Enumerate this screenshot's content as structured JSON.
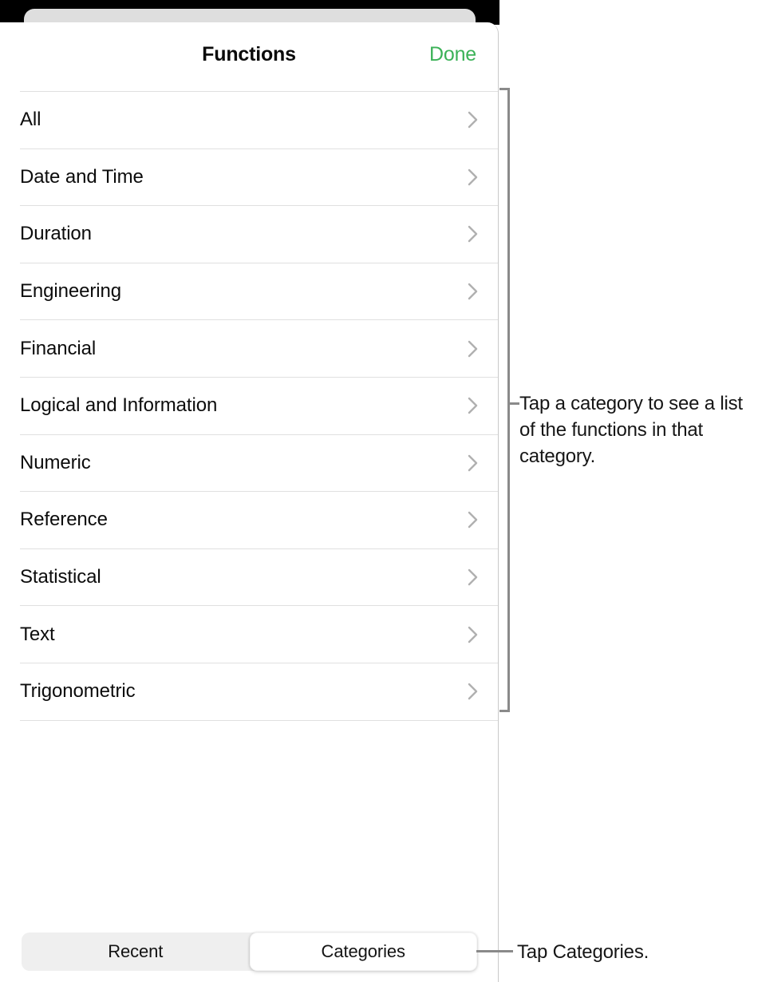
{
  "header": {
    "title": "Functions",
    "done_label": "Done"
  },
  "list": {
    "items": [
      {
        "label": "All",
        "chevron": "chevron-right-icon"
      },
      {
        "label": "Date and Time",
        "chevron": "chevron-right-icon"
      },
      {
        "label": "Duration",
        "chevron": "chevron-right-icon"
      },
      {
        "label": "Engineering",
        "chevron": "chevron-right-icon"
      },
      {
        "label": "Financial",
        "chevron": "chevron-right-icon"
      },
      {
        "label": "Logical and Information",
        "chevron": "chevron-right-icon"
      },
      {
        "label": "Numeric",
        "chevron": "chevron-right-icon"
      },
      {
        "label": "Reference",
        "chevron": "chevron-right-icon"
      },
      {
        "label": "Statistical",
        "chevron": "chevron-right-icon"
      },
      {
        "label": "Text",
        "chevron": "chevron-right-icon"
      },
      {
        "label": "Trigonometric",
        "chevron": "chevron-right-icon"
      }
    ]
  },
  "segmented_control": {
    "options": [
      {
        "label": "Recent",
        "selected": false
      },
      {
        "label": "Categories",
        "selected": true
      }
    ],
    "recent_label": "Recent",
    "categories_label": "Categories"
  },
  "callouts": {
    "list_callout": "Tap a category to see a list of the functions in that category.",
    "categories_callout": "Tap Categories."
  },
  "colors": {
    "accent_green": "#3cb258",
    "separator": "#e0e0e0",
    "chevron": "#b0b0b0",
    "segment_track": "#efefef",
    "callout_line": "#8a8a8a",
    "status_backdrop": "#000000",
    "behind_card": "#dedede"
  }
}
